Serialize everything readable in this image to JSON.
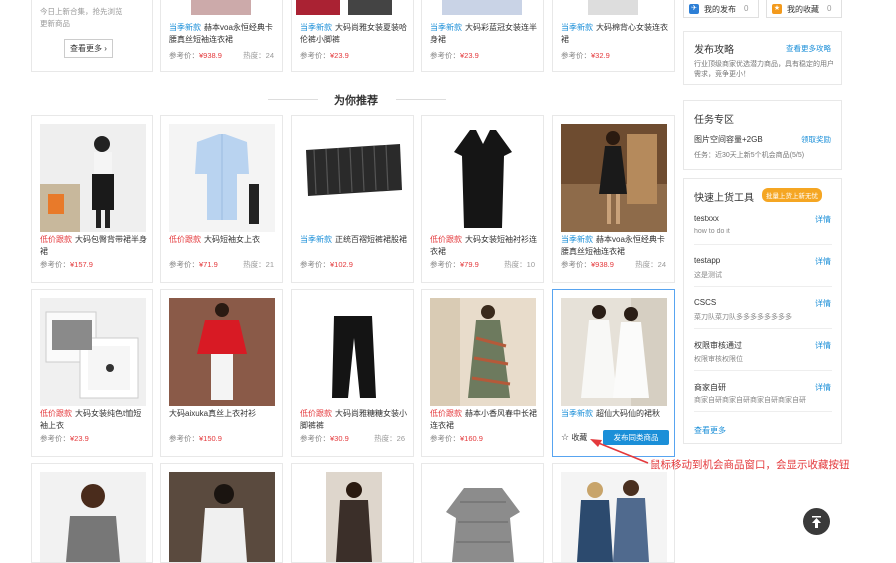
{
  "top_left_promo": {
    "line1": "今日上新合集，抢先浏览",
    "line2": "更新商品",
    "button": "查看更多 ›"
  },
  "top_row": [
    {
      "tag": "当季新款",
      "tag_type": "new",
      "title": "赫本voa永恒经典卡腰真丝短袖连衣裙",
      "price_label": "参考价：",
      "price": "¥938.9",
      "heat": "热度：24"
    },
    {
      "tag": "当季新款",
      "tag_type": "new",
      "title": "大码尚雅女装夏装哈伦裤小脚裤",
      "price_label": "参考价：",
      "price": "¥23.9",
      "heat": ""
    },
    {
      "tag": "当季新款",
      "tag_type": "new",
      "title": "大码彩蓝冠女装连半身裙",
      "price_label": "参考价：",
      "price": "¥23.9",
      "heat": ""
    },
    {
      "tag": "当季新款",
      "tag_type": "new",
      "title": "大码棉背心女装连衣裙",
      "price_label": "参考价：",
      "price": "¥32.9",
      "heat": ""
    }
  ],
  "section_title": "为你推荐",
  "row1": [
    {
      "tag": "低价跟款",
      "tag_type": "sale",
      "title": "大码包臀背带裙半身裙",
      "price_label": "参考价：",
      "price": "¥157.9",
      "heat": ""
    },
    {
      "tag": "低价跟款",
      "tag_type": "sale",
      "title": "大码短袖女上衣",
      "price_label": "参考价：",
      "price": "¥71.9",
      "heat": "热度：21"
    },
    {
      "tag": "当季新款",
      "tag_type": "new",
      "title": "正统百褶短裤裙股裙",
      "price_label": "参考价：",
      "price": "¥102.9",
      "heat": ""
    },
    {
      "tag": "低价跟款",
      "tag_type": "sale",
      "title": "大码女装短袖衬衫连衣裙",
      "price_label": "参考价：",
      "price": "¥79.9",
      "heat": "热度：10"
    },
    {
      "tag": "当季新款",
      "tag_type": "new",
      "title": "赫本voa永恒经典卡腰真丝短袖连衣裙",
      "price_label": "参考价：",
      "price": "¥938.9",
      "heat": "热度：24"
    }
  ],
  "row2": [
    {
      "tag": "低价跟款",
      "tag_type": "sale",
      "title": "大码女装纯色t恤短袖上衣",
      "price_label": "参考价：",
      "price": "¥23.9",
      "heat": ""
    },
    {
      "tag": "",
      "tag_type": "",
      "title": "大码aixuka真丝上衣衬衫",
      "price_label": "参考价：",
      "price": "¥150.9",
      "heat": ""
    },
    {
      "tag": "低价跟款",
      "tag_type": "sale",
      "title": "大码尚雅糖糖女装小脚裤裤",
      "price_label": "参考价：",
      "price": "¥30.9",
      "heat": "热度：26"
    },
    {
      "tag": "低价跟款",
      "tag_type": "sale",
      "title": "赫本小香风春中长裙连衣裙",
      "price_label": "参考价：",
      "price": "¥160.9",
      "heat": ""
    },
    {
      "tag": "当季新款",
      "tag_type": "new",
      "title": "超仙大码仙的裙秋",
      "collect": "收藏",
      "publish": "发布同类商品"
    }
  ],
  "sidebar": {
    "my_publish": "我的发布",
    "my_publish_count": "0",
    "my_collect": "我的收藏",
    "my_collect_count": "0",
    "strategy_title": "发布攻略",
    "strategy_more": "查看更多攻略",
    "strategy_desc": "行业顶级商家优选潜力商品，具有稳定的用户需求，竞争更小！",
    "task_title": "任务专区",
    "task_name": "图片空间容量+2GB",
    "task_claim": "领取奖励",
    "task_desc": "任务：近30天上新5个机会商品(5/5)",
    "tools_title": "快速上货工具",
    "tools_badge": "批量上货上新无忧",
    "tools": [
      {
        "name": "testxxx",
        "desc": "how to do it",
        "detail": "详情"
      },
      {
        "name": "testapp",
        "desc": "这是测试",
        "detail": "详情"
      },
      {
        "name": "CSCS",
        "desc": "菜刀队菜刀队多多多多多多多多",
        "detail": "详情"
      },
      {
        "name": "权限审核通过",
        "desc": "权限审核权限位",
        "detail": "详情"
      },
      {
        "name": "商家自研",
        "desc": "商家自研商家自研商家自研商家自研",
        "detail": "详情"
      }
    ],
    "tools_more": "查看更多"
  },
  "annotation": "鼠标移动到机会商品窗口，会显示收藏按钮",
  "colors": {
    "sale": "#e4393c",
    "new": "#1b8fd8",
    "highlight": "#58a4f0",
    "annotation": "#e4393c"
  }
}
